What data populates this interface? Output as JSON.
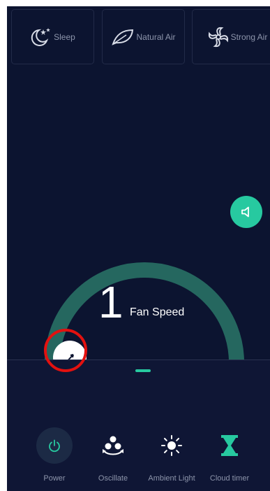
{
  "colors": {
    "background": "#0c1430",
    "accent": "#27c9a0",
    "dial_track": "#25675f",
    "label_gray": "#8d95ab",
    "highlight_ring": "#e3110f"
  },
  "modes": [
    {
      "label": "Sleep",
      "icon": "moon-stars-icon"
    },
    {
      "label": "Natural Air",
      "icon": "leaf-icon"
    },
    {
      "label": "Strong Air",
      "icon": "swirl-fan-icon"
    }
  ],
  "speaker": {
    "icon": "speaker-icon"
  },
  "fan_speed": {
    "value": "1",
    "label": "Fan Speed",
    "level_fraction": 0.0
  },
  "controls": [
    {
      "label": "Power",
      "icon": "power-icon"
    },
    {
      "label": "Oscillate",
      "icon": "oscillate-fan-icon"
    },
    {
      "label": "Ambient Light",
      "icon": "sun-icon"
    },
    {
      "label": "Cloud timer",
      "icon": "hourglass-icon"
    }
  ]
}
